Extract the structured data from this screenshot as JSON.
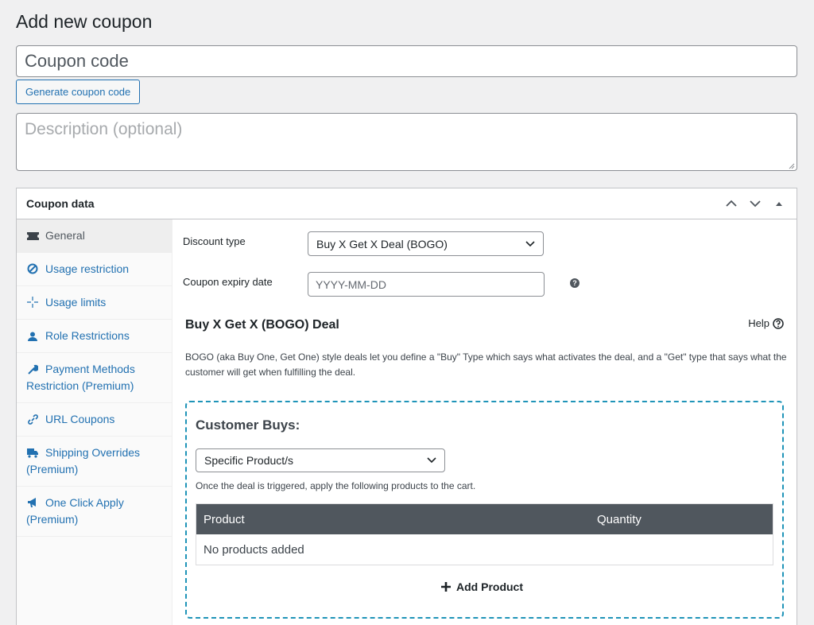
{
  "page": {
    "title": "Add new coupon"
  },
  "coupon_code": {
    "placeholder": "Coupon code",
    "value": ""
  },
  "generate_button": {
    "label": "Generate coupon code"
  },
  "description": {
    "placeholder": "Description (optional)",
    "value": ""
  },
  "coupon_data": {
    "title": "Coupon data",
    "tabs": [
      {
        "label": "General",
        "icon": "ticket-icon",
        "active": true
      },
      {
        "label": "Usage restriction",
        "icon": "block-icon"
      },
      {
        "label": "Usage limits",
        "icon": "crosshair-icon"
      },
      {
        "label": "Role Restrictions",
        "icon": "person-icon"
      },
      {
        "label": "Payment Methods Restriction (Premium)",
        "icon": "wrench-icon"
      },
      {
        "label": "URL Coupons",
        "icon": "link-icon"
      },
      {
        "label": "Shipping Overrides (Premium)",
        "icon": "truck-icon"
      },
      {
        "label": "One Click Apply (Premium)",
        "icon": "megaphone-icon"
      }
    ],
    "general": {
      "discount_type_label": "Discount type",
      "discount_type_value": "Buy X Get X Deal (BOGO)",
      "expiry_label": "Coupon expiry date",
      "expiry_placeholder": "YYYY-MM-DD",
      "help_tip": "?"
    },
    "bogo": {
      "title": "Buy X Get X (BOGO) Deal",
      "help_label": "Help",
      "description": "BOGO (aka Buy One, Get One) style deals let you define a \"Buy\" Type which says what activates the deal, and a \"Get\" type that says what the customer will get when fulfilling the deal.",
      "customer_buys": {
        "title": "Customer Buys:",
        "select_value": "Specific Product/s",
        "note": "Once the deal is triggered, apply the following products to the cart.",
        "table": {
          "columns": [
            "Product",
            "Quantity"
          ],
          "empty_text": "No products added"
        },
        "add_label": "Add Product"
      }
    }
  },
  "colors": {
    "accent": "#2271b1",
    "dashed_border": "#1f94b8",
    "table_header": "#50575e"
  }
}
